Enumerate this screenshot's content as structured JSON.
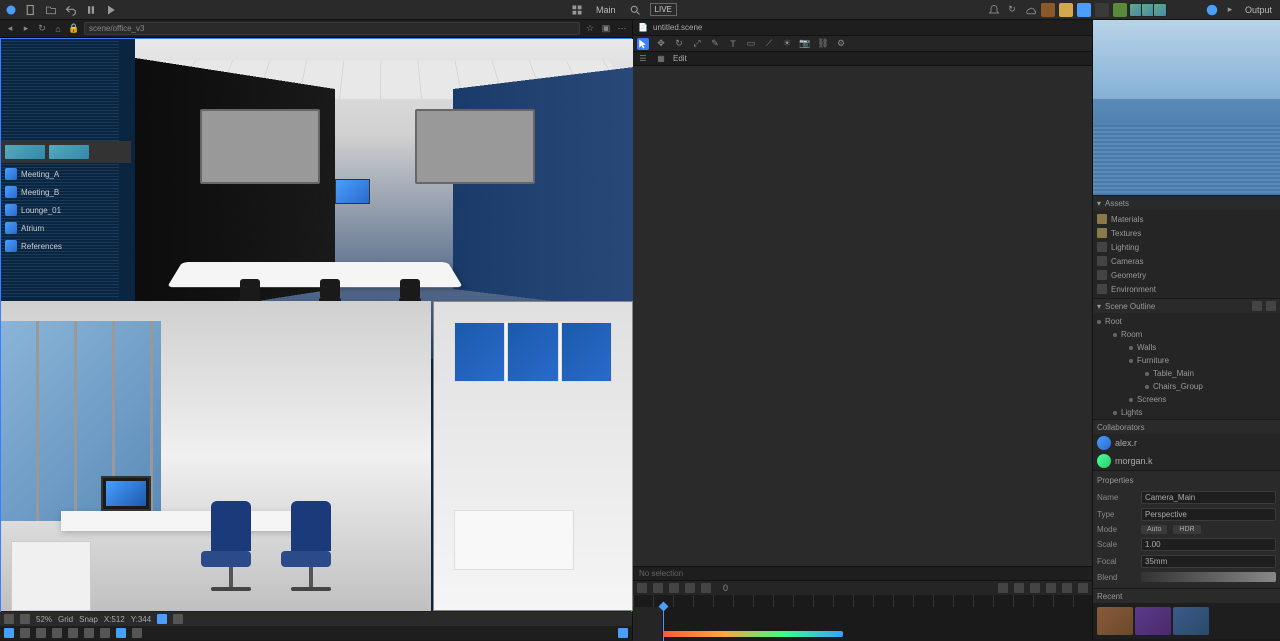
{
  "menubar": {
    "center_label": "Main",
    "badge": "LIVE",
    "right_label": "Output"
  },
  "left": {
    "address": "scene/office_v3",
    "sidebar_items": [
      {
        "label": "Meeting_A"
      },
      {
        "label": "Meeting_B"
      },
      {
        "label": "Lounge_01"
      },
      {
        "label": "Atrium"
      },
      {
        "label": "References"
      }
    ],
    "bottom_stats": {
      "zoom": "52%",
      "grid": "Grid",
      "snap": "Snap",
      "x": "X:512",
      "y": "Y:344"
    }
  },
  "mid": {
    "address": "untitled.scene",
    "tab": "Edit",
    "status": "No selection"
  },
  "timeline": {
    "frame": "0"
  },
  "right": {
    "assets_header": "Assets",
    "items": [
      {
        "label": "Materials"
      },
      {
        "label": "Textures"
      },
      {
        "label": "Lighting"
      },
      {
        "label": "Cameras"
      },
      {
        "label": "Geometry"
      },
      {
        "label": "Environment"
      }
    ],
    "layers_header": "Scene Outline",
    "layers": [
      {
        "label": "Root",
        "indent": 0
      },
      {
        "label": "Room",
        "indent": 1
      },
      {
        "label": "Walls",
        "indent": 2
      },
      {
        "label": "Furniture",
        "indent": 2
      },
      {
        "label": "Table_Main",
        "indent": 3
      },
      {
        "label": "Chairs_Group",
        "indent": 3
      },
      {
        "label": "Screens",
        "indent": 2
      },
      {
        "label": "Lights",
        "indent": 1
      }
    ],
    "users_header": "Collaborators",
    "users": [
      {
        "name": "alex.r"
      },
      {
        "name": "morgan.k"
      }
    ],
    "props_header": "Properties",
    "props": {
      "name_label": "Name",
      "name_val": "Camera_Main",
      "type_label": "Type",
      "type_val": "Perspective",
      "mode_label": "Mode",
      "scale_label": "Scale",
      "scale_val": "1.00",
      "focal_label": "Focal",
      "focal_val": "35mm",
      "blend_label": "Blend"
    },
    "chips": {
      "a": "Auto",
      "b": "HDR"
    },
    "gallery_header": "Recent"
  }
}
